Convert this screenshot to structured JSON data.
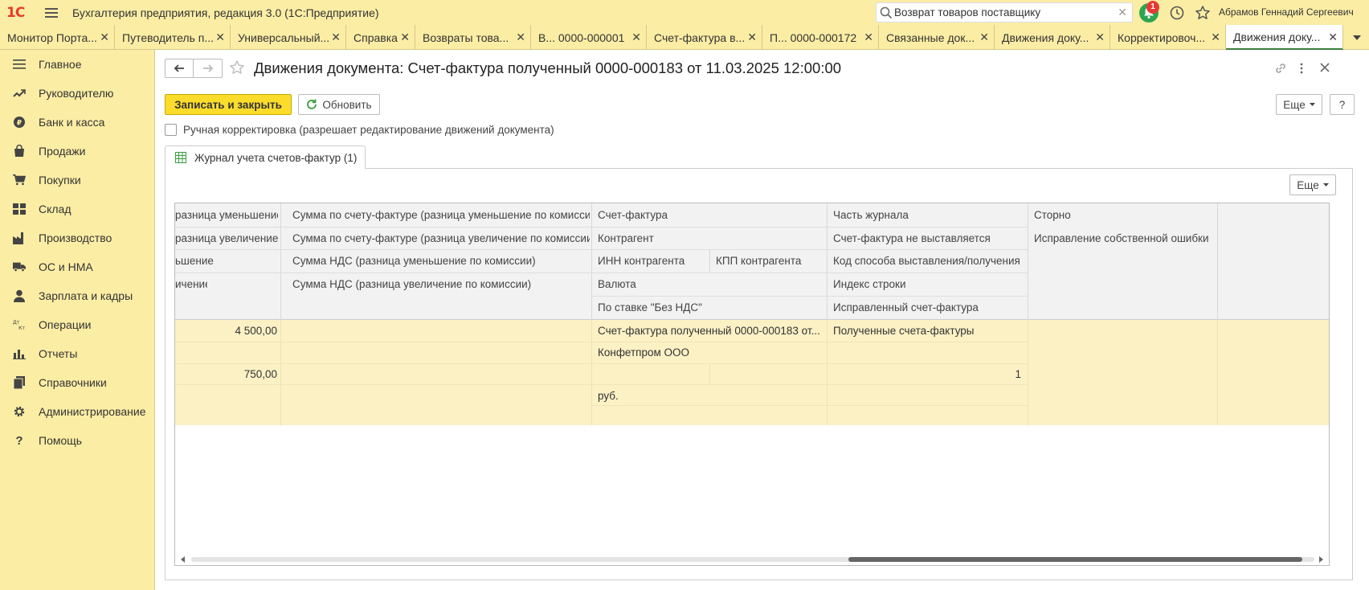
{
  "app": {
    "logo": "1С",
    "title": "Бухгалтерия предприятия, редакция 3.0  (1С:Предприятие)",
    "search_value": "Возврат товаров поставщику",
    "notifications_count": "1",
    "user": "Абрамов Геннадий Сергеевич"
  },
  "tabs": [
    {
      "label": "Монитор Порта..."
    },
    {
      "label": "Путеводитель п..."
    },
    {
      "label": "Универсальный..."
    },
    {
      "label": "Справка"
    },
    {
      "label": "Возвраты това..."
    },
    {
      "label": "В...    0000-000001"
    },
    {
      "label": "Счет-фактура в..."
    },
    {
      "label": "П...    0000-000172"
    },
    {
      "label": "Связанные док..."
    },
    {
      "label": "Движения доку..."
    },
    {
      "label": "Корректировоч..."
    },
    {
      "label": "Движения доку..."
    }
  ],
  "sidebar": {
    "items": [
      {
        "label": "Главное",
        "icon": "menu-lines-icon"
      },
      {
        "label": "Руководителю",
        "icon": "trend-icon"
      },
      {
        "label": "Банк и касса",
        "icon": "coin-icon"
      },
      {
        "label": "Продажи",
        "icon": "bag-icon"
      },
      {
        "label": "Покупки",
        "icon": "cart-icon"
      },
      {
        "label": "Склад",
        "icon": "warehouse-icon"
      },
      {
        "label": "Производство",
        "icon": "factory-icon"
      },
      {
        "label": "ОС и НМА",
        "icon": "truck-icon"
      },
      {
        "label": "Зарплата и кадры",
        "icon": "person-icon"
      },
      {
        "label": "Операции",
        "icon": "dt-kt-icon"
      },
      {
        "label": "Отчеты",
        "icon": "bar-chart-icon"
      },
      {
        "label": "Справочники",
        "icon": "books-icon"
      },
      {
        "label": "Администрирование",
        "icon": "gear-icon"
      },
      {
        "label": "Помощь",
        "icon": "question-icon"
      }
    ]
  },
  "document": {
    "title": "Движения документа: Счет-фактура полученный 0000-000183 от 11.03.2025 12:00:00",
    "save_close_label": "Записать и закрыть",
    "refresh_label": "Обновить",
    "more_label": "Еще",
    "help_label": "?",
    "manual_correction_label": "Ручная корректировка (разрешает редактирование движений документа)",
    "page_tab_label": "Журнал учета счетов-фактур (1)",
    "table_more_label": "Еще"
  },
  "table": {
    "headers": {
      "c1r1": "разница уменьшение)",
      "c1r2": "разница увеличение)",
      "c1r3": "ьшение)",
      "c1r4": "ичение)",
      "c2r1": "Сумма по счету-фактуре (разница уменьшение по комиссии)",
      "c2r2": "Сумма по счету-фактуре (разница увеличение по комиссии)",
      "c2r3": "Сумма НДС (разница уменьшение по комиссии)",
      "c2r4": "Сумма НДС (разница увеличение по комиссии)",
      "c3r1": "Счет-фактура",
      "c3r2": "Контрагент",
      "c3r3a": "ИНН контрагента",
      "c3r3b": "КПП контрагента",
      "c3r4": "Валюта",
      "c3r5": "По ставке \"Без НДС\"",
      "c4r1": "Часть журнала",
      "c4r2": "Счет-фактура не выставляется",
      "c4r3": "Код способа выставления/получения",
      "c4r4": "Индекс строки",
      "c4r5": "Исправленный счет-фактура",
      "c5r1": "Сторно",
      "c5r2": "Исправление собственной ошибки"
    },
    "row": {
      "c1r1": "4 500,00",
      "c1r3": "750,00",
      "c3r1": "Счет-фактура полученный 0000-000183 от...",
      "c3r2": "Конфетпром ООО",
      "c3r4": "руб.",
      "c4r1": "Полученные счета-фактуры",
      "c4r3": "1"
    }
  }
}
